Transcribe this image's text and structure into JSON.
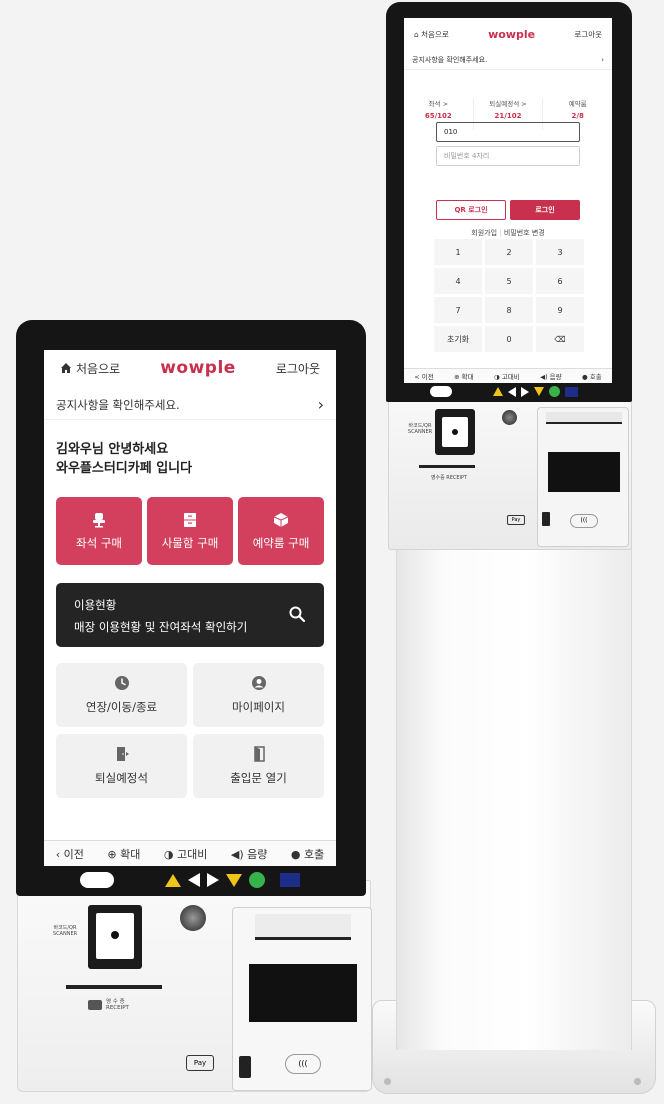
{
  "kiosk_tall": {
    "header": {
      "home_label": "처음으로",
      "logo": "wowple",
      "logout_label": "로그아웃"
    },
    "notice": "공지사항을 확인해주세요.",
    "stats": [
      {
        "label": "좌석 >",
        "value": "65/102"
      },
      {
        "label": "퇴실예정석 >",
        "value": "21/102"
      },
      {
        "label": "예약룸",
        "value": "2/8"
      }
    ],
    "phone_value": "010",
    "password_placeholder": "비밀번호 4자리",
    "qr_login_label": "QR 로그인",
    "login_label": "로그인",
    "signup_label": "회원가입",
    "change_password_label": "비밀번호 변경",
    "keypad": [
      "1",
      "2",
      "3",
      "4",
      "5",
      "6",
      "7",
      "8",
      "9",
      "초기화",
      "0",
      "⌫"
    ],
    "bottom": [
      "< 이전",
      "⊕ 확대",
      "◑ 고대비",
      "◀) 음량",
      "● 호출"
    ],
    "hardware": {
      "scanner_label": "바코드/QR SCANNER",
      "receipt_label": "영수증 RECEIPT",
      "pay_label": "Pay"
    }
  },
  "kiosk_short": {
    "header": {
      "home_label": "처음으로",
      "logo": "wowple",
      "logout_label": "로그아웃"
    },
    "notice": "공지사항을 확인해주세요.",
    "greeting_line1": "김와우님 안녕하세요",
    "greeting_line2": "와우플스터디카페 입니다",
    "main_buttons": [
      {
        "label": "좌석 구매",
        "icon": "chair-icon"
      },
      {
        "label": "사물함 구매",
        "icon": "locker-icon"
      },
      {
        "label": "예약룸 구매",
        "icon": "cube-icon"
      }
    ],
    "usage": {
      "title": "이용현황",
      "subtitle": "매장 이용현황 및 잔여좌석 확인하기"
    },
    "grid_buttons": [
      {
        "label": "연장/이동/종료",
        "icon": "clock-icon"
      },
      {
        "label": "마이페이지",
        "icon": "user-icon"
      },
      {
        "label": "퇴실예정석",
        "icon": "exit-door-icon"
      },
      {
        "label": "출입문 열기",
        "icon": "door-icon"
      }
    ],
    "bottom": [
      {
        "label": "이전",
        "icon": "chevron-left-icon"
      },
      {
        "label": "확대",
        "icon": "zoom-icon"
      },
      {
        "label": "고대비",
        "icon": "contrast-icon"
      },
      {
        "label": "음량",
        "icon": "volume-icon"
      },
      {
        "label": "호출",
        "icon": "bell-icon"
      }
    ],
    "hardware": {
      "scanner_label_1": "바코드/QR",
      "scanner_label_2": "SCANNER",
      "receipt_label_1": "영 수 증",
      "receipt_label_2": "RECEIPT",
      "pay_label": "Pay"
    }
  },
  "colors": {
    "accent": "#d3405e",
    "dark_card": "#242424",
    "gray_card": "#f1f1f1",
    "frame": "#151515"
  }
}
